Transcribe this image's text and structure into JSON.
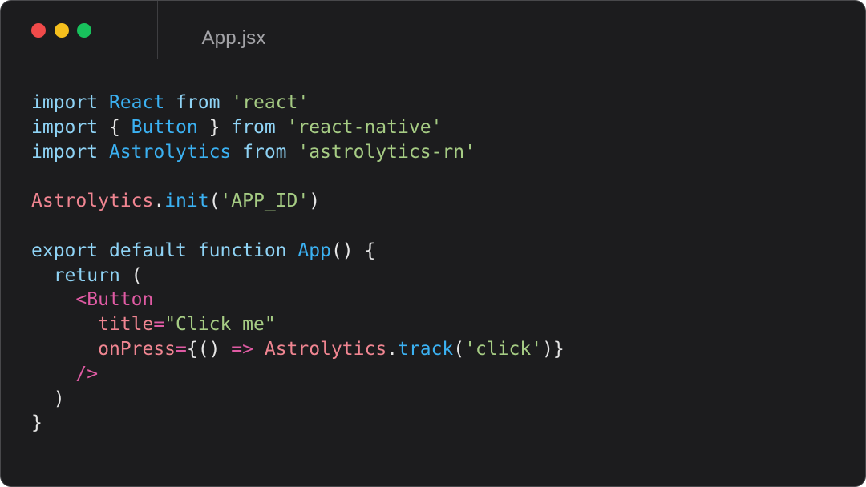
{
  "window": {
    "traffic_lights": {
      "close_color": "#f04a4a",
      "minimize_color": "#f5bf1d",
      "zoom_color": "#18c15c"
    },
    "tab": {
      "label": "App.jsx"
    }
  },
  "theme": {
    "background": "#1c1c1e",
    "keyword": "#8fd3f5",
    "identifier": "#3bb1f2",
    "string": "#a6cc84",
    "variable": "#f08591",
    "tag": "#e05ba4",
    "punctuation": "#e6e6e6"
  },
  "code": {
    "lines": [
      [
        {
          "text": "import",
          "kind": "keyword"
        },
        {
          "text": " ",
          "kind": "plain"
        },
        {
          "text": "React",
          "kind": "identifier"
        },
        {
          "text": " ",
          "kind": "plain"
        },
        {
          "text": "from",
          "kind": "keyword"
        },
        {
          "text": " ",
          "kind": "plain"
        },
        {
          "text": "'react'",
          "kind": "string"
        }
      ],
      [
        {
          "text": "import",
          "kind": "keyword"
        },
        {
          "text": " { ",
          "kind": "plain"
        },
        {
          "text": "Button",
          "kind": "identifier"
        },
        {
          "text": " } ",
          "kind": "plain"
        },
        {
          "text": "from",
          "kind": "keyword"
        },
        {
          "text": " ",
          "kind": "plain"
        },
        {
          "text": "'react-native'",
          "kind": "string"
        }
      ],
      [
        {
          "text": "import",
          "kind": "keyword"
        },
        {
          "text": " ",
          "kind": "plain"
        },
        {
          "text": "Astrolytics",
          "kind": "identifier"
        },
        {
          "text": " ",
          "kind": "plain"
        },
        {
          "text": "from",
          "kind": "keyword"
        },
        {
          "text": " ",
          "kind": "plain"
        },
        {
          "text": "'astrolytics-rn'",
          "kind": "string"
        }
      ],
      [],
      [
        {
          "text": "Astrolytics",
          "kind": "variable"
        },
        {
          "text": ".",
          "kind": "plain"
        },
        {
          "text": "init",
          "kind": "identifier"
        },
        {
          "text": "(",
          "kind": "plain"
        },
        {
          "text": "'APP_ID'",
          "kind": "string"
        },
        {
          "text": ")",
          "kind": "plain"
        }
      ],
      [],
      [
        {
          "text": "export",
          "kind": "keyword"
        },
        {
          "text": " ",
          "kind": "plain"
        },
        {
          "text": "default",
          "kind": "keyword"
        },
        {
          "text": " ",
          "kind": "plain"
        },
        {
          "text": "function",
          "kind": "keyword"
        },
        {
          "text": " ",
          "kind": "plain"
        },
        {
          "text": "App",
          "kind": "identifier"
        },
        {
          "text": "() {",
          "kind": "plain"
        }
      ],
      [
        {
          "text": "  ",
          "kind": "plain"
        },
        {
          "text": "return",
          "kind": "keyword"
        },
        {
          "text": " (",
          "kind": "plain"
        }
      ],
      [
        {
          "text": "    ",
          "kind": "plain"
        },
        {
          "text": "<Button",
          "kind": "tag"
        }
      ],
      [
        {
          "text": "      ",
          "kind": "plain"
        },
        {
          "text": "title",
          "kind": "variable"
        },
        {
          "text": "=",
          "kind": "tag"
        },
        {
          "text": "\"Click me\"",
          "kind": "string"
        }
      ],
      [
        {
          "text": "      ",
          "kind": "plain"
        },
        {
          "text": "onPress",
          "kind": "variable"
        },
        {
          "text": "=",
          "kind": "tag"
        },
        {
          "text": "{() ",
          "kind": "plain"
        },
        {
          "text": "=>",
          "kind": "tag"
        },
        {
          "text": " ",
          "kind": "plain"
        },
        {
          "text": "Astrolytics",
          "kind": "variable"
        },
        {
          "text": ".",
          "kind": "plain"
        },
        {
          "text": "track",
          "kind": "identifier"
        },
        {
          "text": "(",
          "kind": "plain"
        },
        {
          "text": "'click'",
          "kind": "string"
        },
        {
          "text": ")}",
          "kind": "plain"
        }
      ],
      [
        {
          "text": "    ",
          "kind": "plain"
        },
        {
          "text": "/>",
          "kind": "tag"
        }
      ],
      [
        {
          "text": "  )",
          "kind": "plain"
        }
      ],
      [
        {
          "text": "}",
          "kind": "plain"
        }
      ]
    ]
  }
}
